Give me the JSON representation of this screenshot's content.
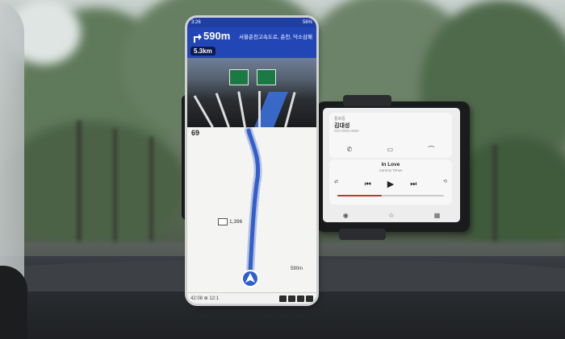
{
  "status_bar": {
    "time": "3:26",
    "battery": "56%"
  },
  "navigation": {
    "distance": "590m",
    "road": "서울춘천고속도로, 춘천, 덕소삼패",
    "sub_distance": "5.3km",
    "speed_limit": "69",
    "poi_label": "1,396",
    "remaining_distance": "590m",
    "bottom_left": "42:08 ⊕ 12:1"
  },
  "call": {
    "subtitle": "통화중",
    "caller": "김대성",
    "number": "010-0000-0000",
    "actions": [
      "call-icon",
      "message-icon",
      "end-call-icon"
    ]
  },
  "music": {
    "song": "In Love",
    "artist": "Cammy Tenus",
    "progress": 0.42,
    "controls": [
      "previous-icon",
      "play-icon",
      "next-icon"
    ]
  },
  "colors": {
    "nav_blue": "#2346b7",
    "route_blue": "#2f5fd0",
    "accent_red": "#c0392b"
  }
}
